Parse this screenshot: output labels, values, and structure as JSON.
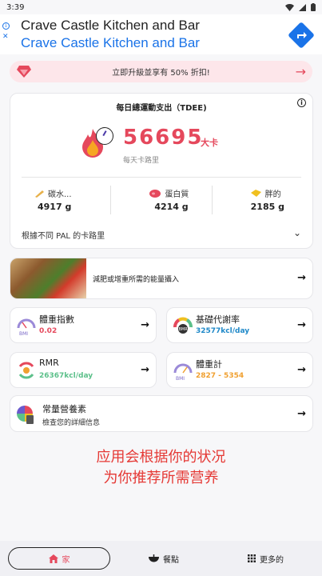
{
  "status_bar": {
    "time": "3:39"
  },
  "ad": {
    "title": "Crave Castle Kitchen and Bar",
    "subtitle": "Crave Castle Kitchen and Bar",
    "info_icon": "i",
    "close_icon": "✕"
  },
  "promo": {
    "text": "立即升級並享有 50% 折扣!",
    "arrow": "→"
  },
  "tdee": {
    "title": "每日總運動支出（TDEE)",
    "value": "56695",
    "unit": "大卡",
    "sub": "每天卡路里",
    "macros": [
      {
        "label": "碳水...",
        "value": "4917 g",
        "color": "#e8b14a"
      },
      {
        "label": "蛋白質",
        "value": "4214 g",
        "color": "#e5485c"
      },
      {
        "label": "胖的",
        "value": "2185 g",
        "color": "#f0c020"
      }
    ],
    "pal_text": "根據不同 PAL 的卡路里",
    "chevron": "⌄"
  },
  "food_row": {
    "text": "減肥或增重所需的能量攝入",
    "arrow": "→"
  },
  "grid": [
    {
      "title": "體重指數",
      "value": "0.02",
      "color": "#e5485c",
      "arrow": "→",
      "icon": "bmi-gauge-icon"
    },
    {
      "title": "基礎代謝率",
      "value": "32577kcl/day",
      "color": "#1e88c8",
      "arrow": "→",
      "icon": "bmr-gauge-icon"
    },
    {
      "title": "RMR",
      "value": "26367kcl/day",
      "color": "#5cc08a",
      "arrow": "→",
      "icon": "rmr-icon"
    },
    {
      "title": "體重計",
      "value": "2827 - 5354",
      "color": "#f0a030",
      "arrow": "→",
      "icon": "scale-icon"
    }
  ],
  "nutrients": {
    "title": "常量營養素",
    "sub": "檢查您的詳細信息",
    "arrow": "→"
  },
  "caption": {
    "line1": "应用会根据你的状况",
    "line2": "为你推荐所需营养"
  },
  "bottom_nav": {
    "home": "家",
    "meals": "餐點",
    "more": "更多的"
  }
}
